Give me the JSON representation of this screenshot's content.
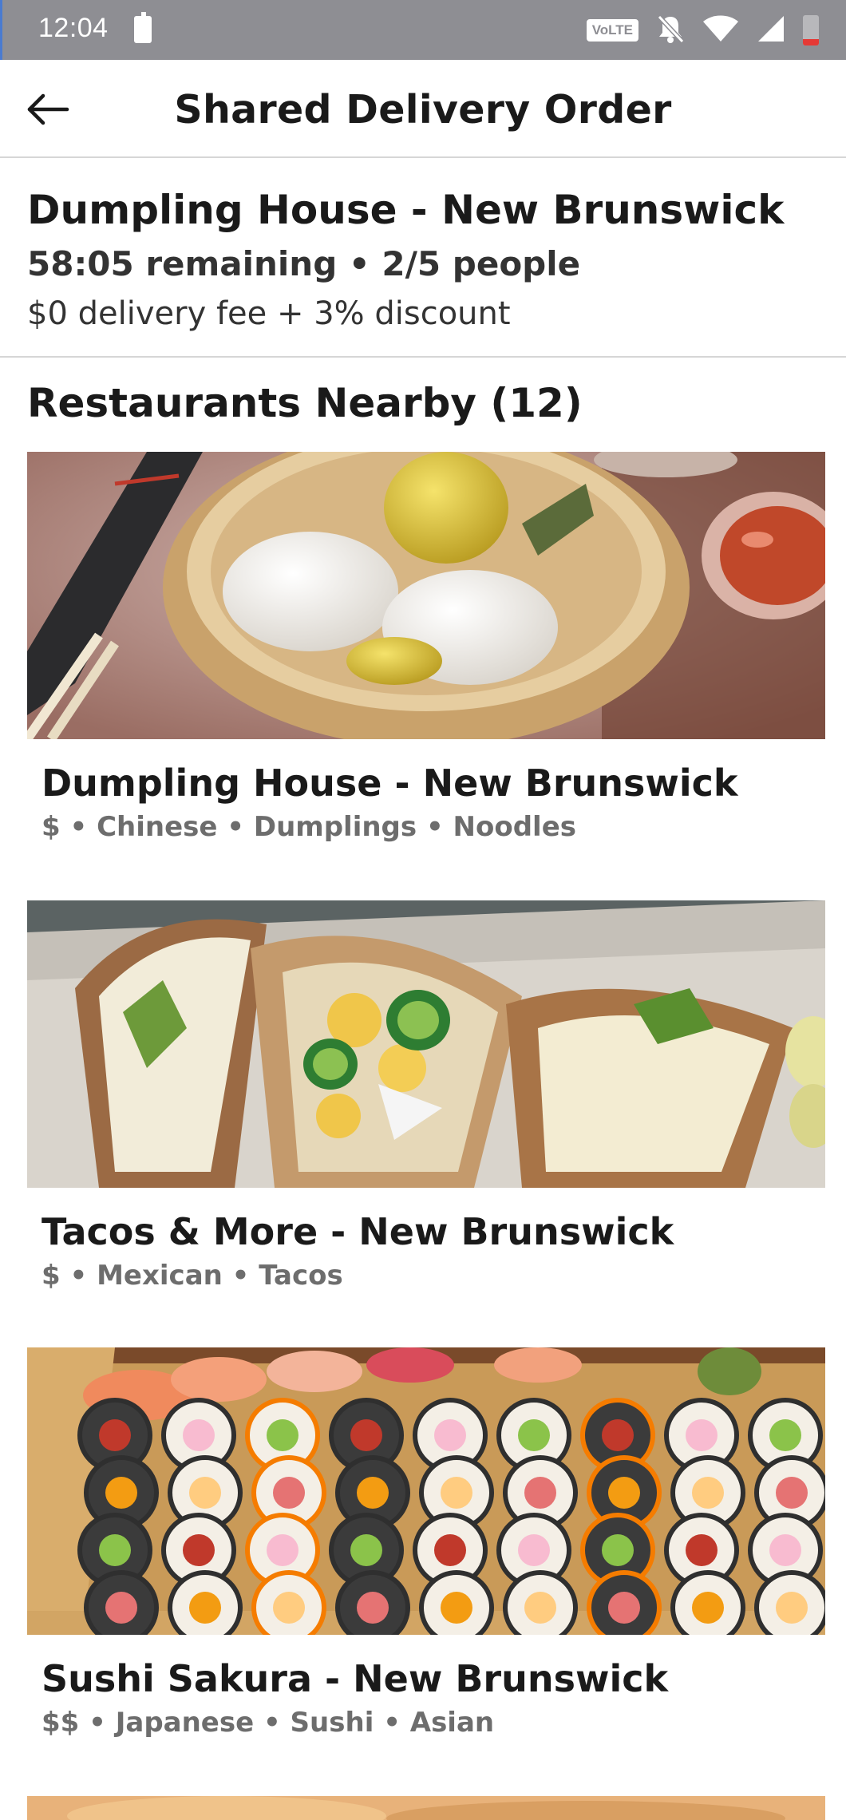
{
  "status_bar": {
    "time": "12:04",
    "network_badge": "VoLTE",
    "icons": [
      "battery-saver-icon",
      "volte-icon",
      "notifications-muted-icon",
      "wifi-icon",
      "cell-signal-icon",
      "battery-low-icon"
    ]
  },
  "header": {
    "title": "Shared Delivery Order",
    "back_icon": "back-arrow-icon"
  },
  "order": {
    "restaurant": "Dumpling House - New Brunswick",
    "status": "58:05 remaining • 2/5 people",
    "discount": "$0 delivery fee +  3% discount"
  },
  "section": {
    "title": "Restaurants Nearby (12)"
  },
  "restaurants": [
    {
      "name": "Dumpling House - New Brunswick",
      "meta": "$ • Chinese • Dumplings • Noodles",
      "photo": "dumplings-photo"
    },
    {
      "name": "Tacos & More - New Brunswick",
      "meta": "$ • Mexican • Tacos",
      "photo": "tacos-photo"
    },
    {
      "name": "Sushi Sakura - New Brunswick",
      "meta": "$$ • Japanese • Sushi • Asian",
      "photo": "sushi-photo"
    }
  ],
  "colors": {
    "status_bar": "#8e8e93",
    "text_primary": "#1a1a1a",
    "text_secondary": "#6d6d6d",
    "divider": "#d6d6d6",
    "battery_low": "#e53935"
  }
}
